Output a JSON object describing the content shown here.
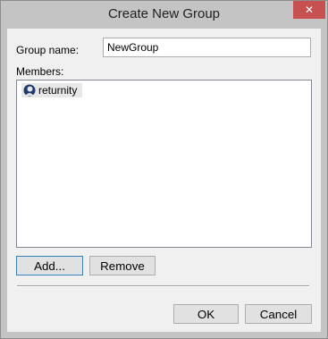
{
  "window": {
    "title": "Create New Group",
    "close_glyph": "✕"
  },
  "form": {
    "group_name_label": "Group name:",
    "group_name_value": "NewGroup",
    "members_label": "Members:",
    "members": [
      {
        "name": "returnity",
        "icon": "user-icon"
      }
    ]
  },
  "buttons": {
    "add": "Add...",
    "remove": "Remove",
    "ok": "OK",
    "cancel": "Cancel"
  },
  "colors": {
    "frame": "#c4c4c4",
    "client": "#f0f0f0",
    "close": "#c75050",
    "selection": "#e8e8e8"
  }
}
